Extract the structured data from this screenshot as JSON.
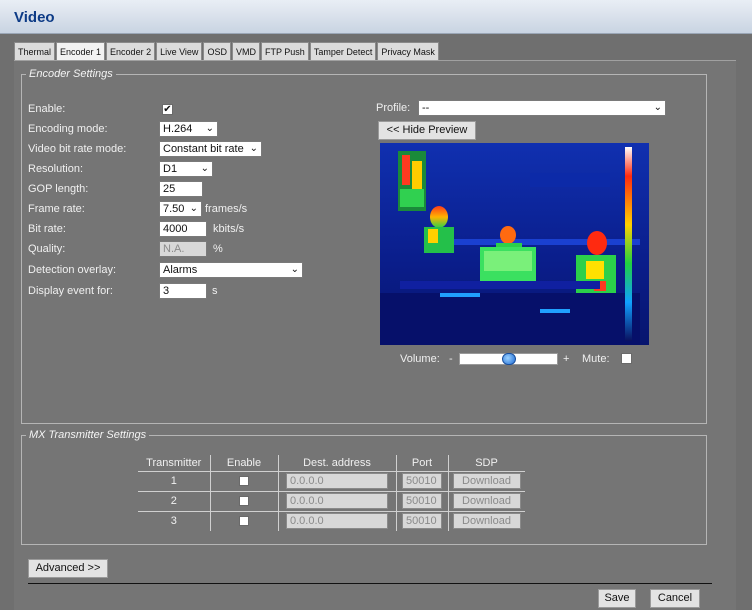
{
  "window": {
    "title": "Video"
  },
  "tabs": [
    {
      "label": "Thermal",
      "active": false
    },
    {
      "label": "Encoder 1",
      "active": true
    },
    {
      "label": "Encoder 2",
      "active": false
    },
    {
      "label": "Live View",
      "active": false
    },
    {
      "label": "OSD",
      "active": false
    },
    {
      "label": "VMD",
      "active": false
    },
    {
      "label": "FTP Push",
      "active": false
    },
    {
      "label": "Tamper Detect",
      "active": false
    },
    {
      "label": "Privacy Mask",
      "active": false
    }
  ],
  "encoder": {
    "legend": "Encoder Settings",
    "enable_label": "Enable:",
    "enable_checked": true,
    "enable_mark": "✔",
    "encoding_mode_label": "Encoding mode:",
    "encoding_mode_value": "H.264",
    "bitrate_mode_label": "Video bit rate mode:",
    "bitrate_mode_value": "Constant bit rate",
    "resolution_label": "Resolution:",
    "resolution_value": "D1",
    "gop_label": "GOP length:",
    "gop_value": "25",
    "frame_rate_label": "Frame rate:",
    "frame_rate_value": "7.50",
    "frame_rate_unit": "frames/s",
    "bit_rate_label": "Bit rate:",
    "bit_rate_value": "4000",
    "bit_rate_unit": "kbits/s",
    "quality_label": "Quality:",
    "quality_value": "N.A.",
    "quality_unit": "%",
    "overlay_label": "Detection overlay:",
    "overlay_value": "Alarms",
    "display_event_label": "Display event for:",
    "display_event_value": "3",
    "display_event_unit": "s",
    "profile_label": "Profile:",
    "profile_value": "--",
    "hide_preview_label": "<< Hide Preview",
    "volume_label": "Volume:",
    "volume_minus": "-",
    "volume_plus": "+",
    "volume_level": 0.5,
    "mute_label": "Mute:",
    "chevron": "⌄"
  },
  "mx": {
    "legend": "MX Transmitter Settings",
    "headers": [
      "Transmitter",
      "Enable",
      "Dest. address",
      "Port",
      "SDP"
    ],
    "rows": [
      {
        "id": "1",
        "address": "0.0.0.0",
        "port": "50010",
        "sdp": "Download"
      },
      {
        "id": "2",
        "address": "0.0.0.0",
        "port": "50010",
        "sdp": "Download"
      },
      {
        "id": "3",
        "address": "0.0.0.0",
        "port": "50010",
        "sdp": "Download"
      }
    ]
  },
  "footer": {
    "advanced_label": "Advanced >>",
    "save_label": "Save",
    "cancel_label": "Cancel"
  },
  "colors": {
    "title": "#0d3b86",
    "background": "#757575",
    "thermal_cold": "#0e1e9a",
    "thermal_hot": "#e02020"
  }
}
